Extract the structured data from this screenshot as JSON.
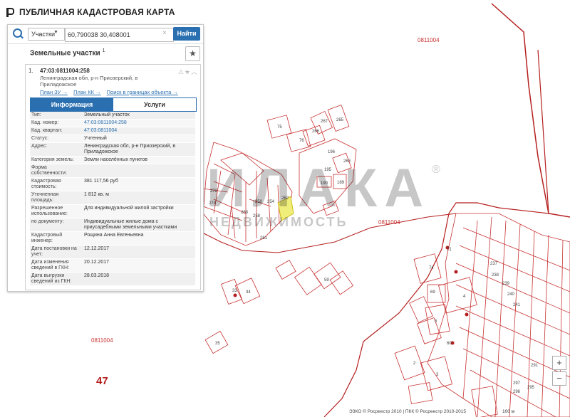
{
  "app": {
    "title": "ПУБЛИЧНАЯ КАДАСТРОВАЯ КАРТА"
  },
  "search": {
    "type": "Участки",
    "query": "60,790038 30,408001",
    "button": "Найти"
  },
  "panel": {
    "title": "Земельные участки",
    "count": "1",
    "result": {
      "index": "1.",
      "cadastral_number": "47:03:0811004:258",
      "address": "Ленинградская обл, р-н Приозерский, в Приладожское",
      "links": [
        "План ЗУ →",
        "План КК →",
        "Поиск в границах объекта →"
      ],
      "tabs": [
        "Информация",
        "Услуги"
      ],
      "rows": [
        {
          "key": "Тип:",
          "value": "Земельный участок"
        },
        {
          "key": "Кад. номер:",
          "value": "47:03:0811004:258"
        },
        {
          "key": "Кад. квартал:",
          "value": "47:03:0811004"
        },
        {
          "key": "Статус:",
          "value": "Учтенный"
        },
        {
          "key": "Адрес:",
          "value": "Ленинградская обл, р-н Приозерский, в Приладожское"
        },
        {
          "key": "Категория земель:",
          "value": "Земли населённых пунктов"
        },
        {
          "key": "Форма собственности:",
          "value": ""
        },
        {
          "key": "Кадастровая стоимость:",
          "value": "381 117,56 руб"
        },
        {
          "key": "Уточненная площадь:",
          "value": "1 812 кв. м"
        },
        {
          "key": "Разрешенное использование:",
          "value": "Для индивидуальной жилой застройки"
        },
        {
          "key": "по документу:",
          "value": "Индивидуальные жилые дома с приусадебными земельными участками"
        },
        {
          "key": "Кадастровый инженер:",
          "value": "Рощина Анна Евгеньевна"
        },
        {
          "key": "Дата постановки на учет:",
          "value": "12.12.2017"
        },
        {
          "key": "Дата изменения сведений в ГКН:",
          "value": "20.12.2017"
        },
        {
          "key": "Дата выгрузки сведений из ГКН:",
          "value": "28.03.2018"
        }
      ]
    }
  },
  "map": {
    "quarter_labels": [
      "0811004",
      "0811004",
      "0811004"
    ],
    "district_label": "47",
    "plot_numbers": [
      "75",
      "76",
      "267",
      "266",
      "265",
      "263",
      "190",
      "189",
      "195",
      "196",
      "262",
      "254",
      "272",
      "274",
      "268",
      "261",
      "258",
      "250",
      "34",
      "33",
      "35",
      "59",
      "71",
      "74",
      "237",
      "238",
      "239",
      "240",
      "241",
      "4",
      "5",
      "3",
      "2",
      "60",
      "69",
      "297",
      "296",
      "295",
      "291"
    ],
    "watermark": "ИЛАКА",
    "watermark_sub": "НЕДВИЖИМОСТЬ",
    "watermark_mark": "®",
    "copyright": "ЭЗКО © Росреестр 2010 | ПКК © Росреестр 2010-2015",
    "scale": "100 м",
    "colors": {
      "plot_border": "#c83232",
      "boundary": "#b51f1f",
      "highlight": "#f0ee7a",
      "accent": "#2a6fb0"
    }
  }
}
